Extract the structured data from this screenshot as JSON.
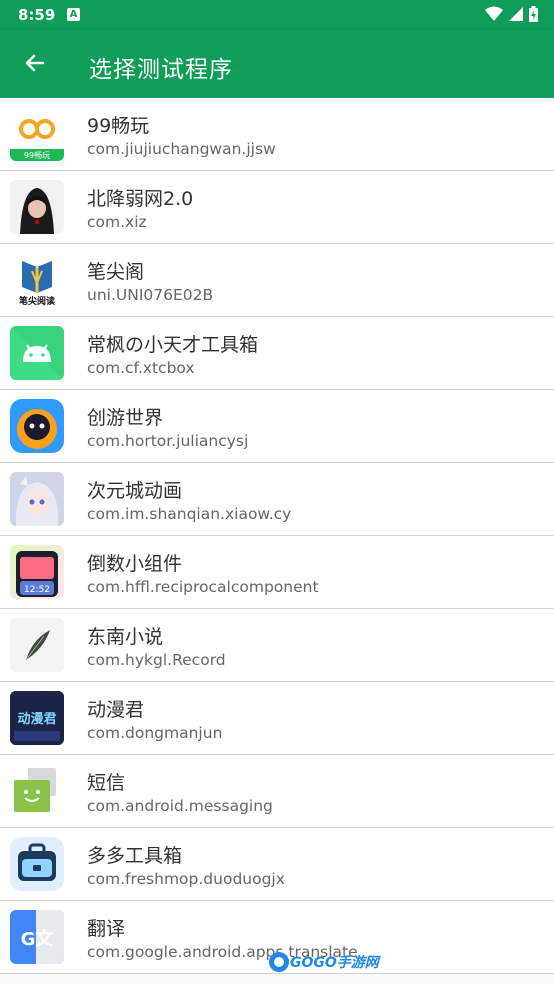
{
  "status": {
    "time": "8:59",
    "a_badge": "A"
  },
  "appbar": {
    "title": "选择测试程序"
  },
  "apps": [
    {
      "name": "99畅玩",
      "pkg": "com.jiujiuchangwan.jjsw",
      "icon": "99-changwan-icon",
      "icon_label": "99畅玩"
    },
    {
      "name": "北降弱网2.0",
      "pkg": "com.xiz",
      "icon": "hooded-avatar-icon"
    },
    {
      "name": "笔尖阁",
      "pkg": "uni.UNI076E02B",
      "icon": "book-reader-icon",
      "icon_label": "笔尖阅读"
    },
    {
      "name": "常枫の小天才工具箱",
      "pkg": "com.cf.xtcbox",
      "icon": "android-robot-icon"
    },
    {
      "name": "创游世界",
      "pkg": "com.hortor.juliancysj",
      "icon": "game-character-icon"
    },
    {
      "name": "次元城动画",
      "pkg": "com.im.shanqian.xiaow.cy",
      "icon": "anime-girl-icon"
    },
    {
      "name": "倒数小组件",
      "pkg": "com.hffl.reciprocalcomponent",
      "icon": "phone-widget-icon",
      "icon_label": "12:52"
    },
    {
      "name": "东南小说",
      "pkg": "com.hykgl.Record",
      "icon": "feather-icon"
    },
    {
      "name": "动漫君",
      "pkg": "com.dongmanjun",
      "icon": "dongmanjun-icon",
      "icon_label": "动漫君"
    },
    {
      "name": "短信",
      "pkg": "com.android.messaging",
      "icon": "messaging-icon"
    },
    {
      "name": "多多工具箱",
      "pkg": "com.freshmop.duoduogjx",
      "icon": "toolbox-icon"
    },
    {
      "name": "翻译",
      "pkg": "com.google.android.apps.translate",
      "icon": "google-translate-icon",
      "icon_label": "G文"
    }
  ],
  "watermark": {
    "text": "GOGO手游网"
  },
  "colors": {
    "primary": "#0f9d58"
  }
}
